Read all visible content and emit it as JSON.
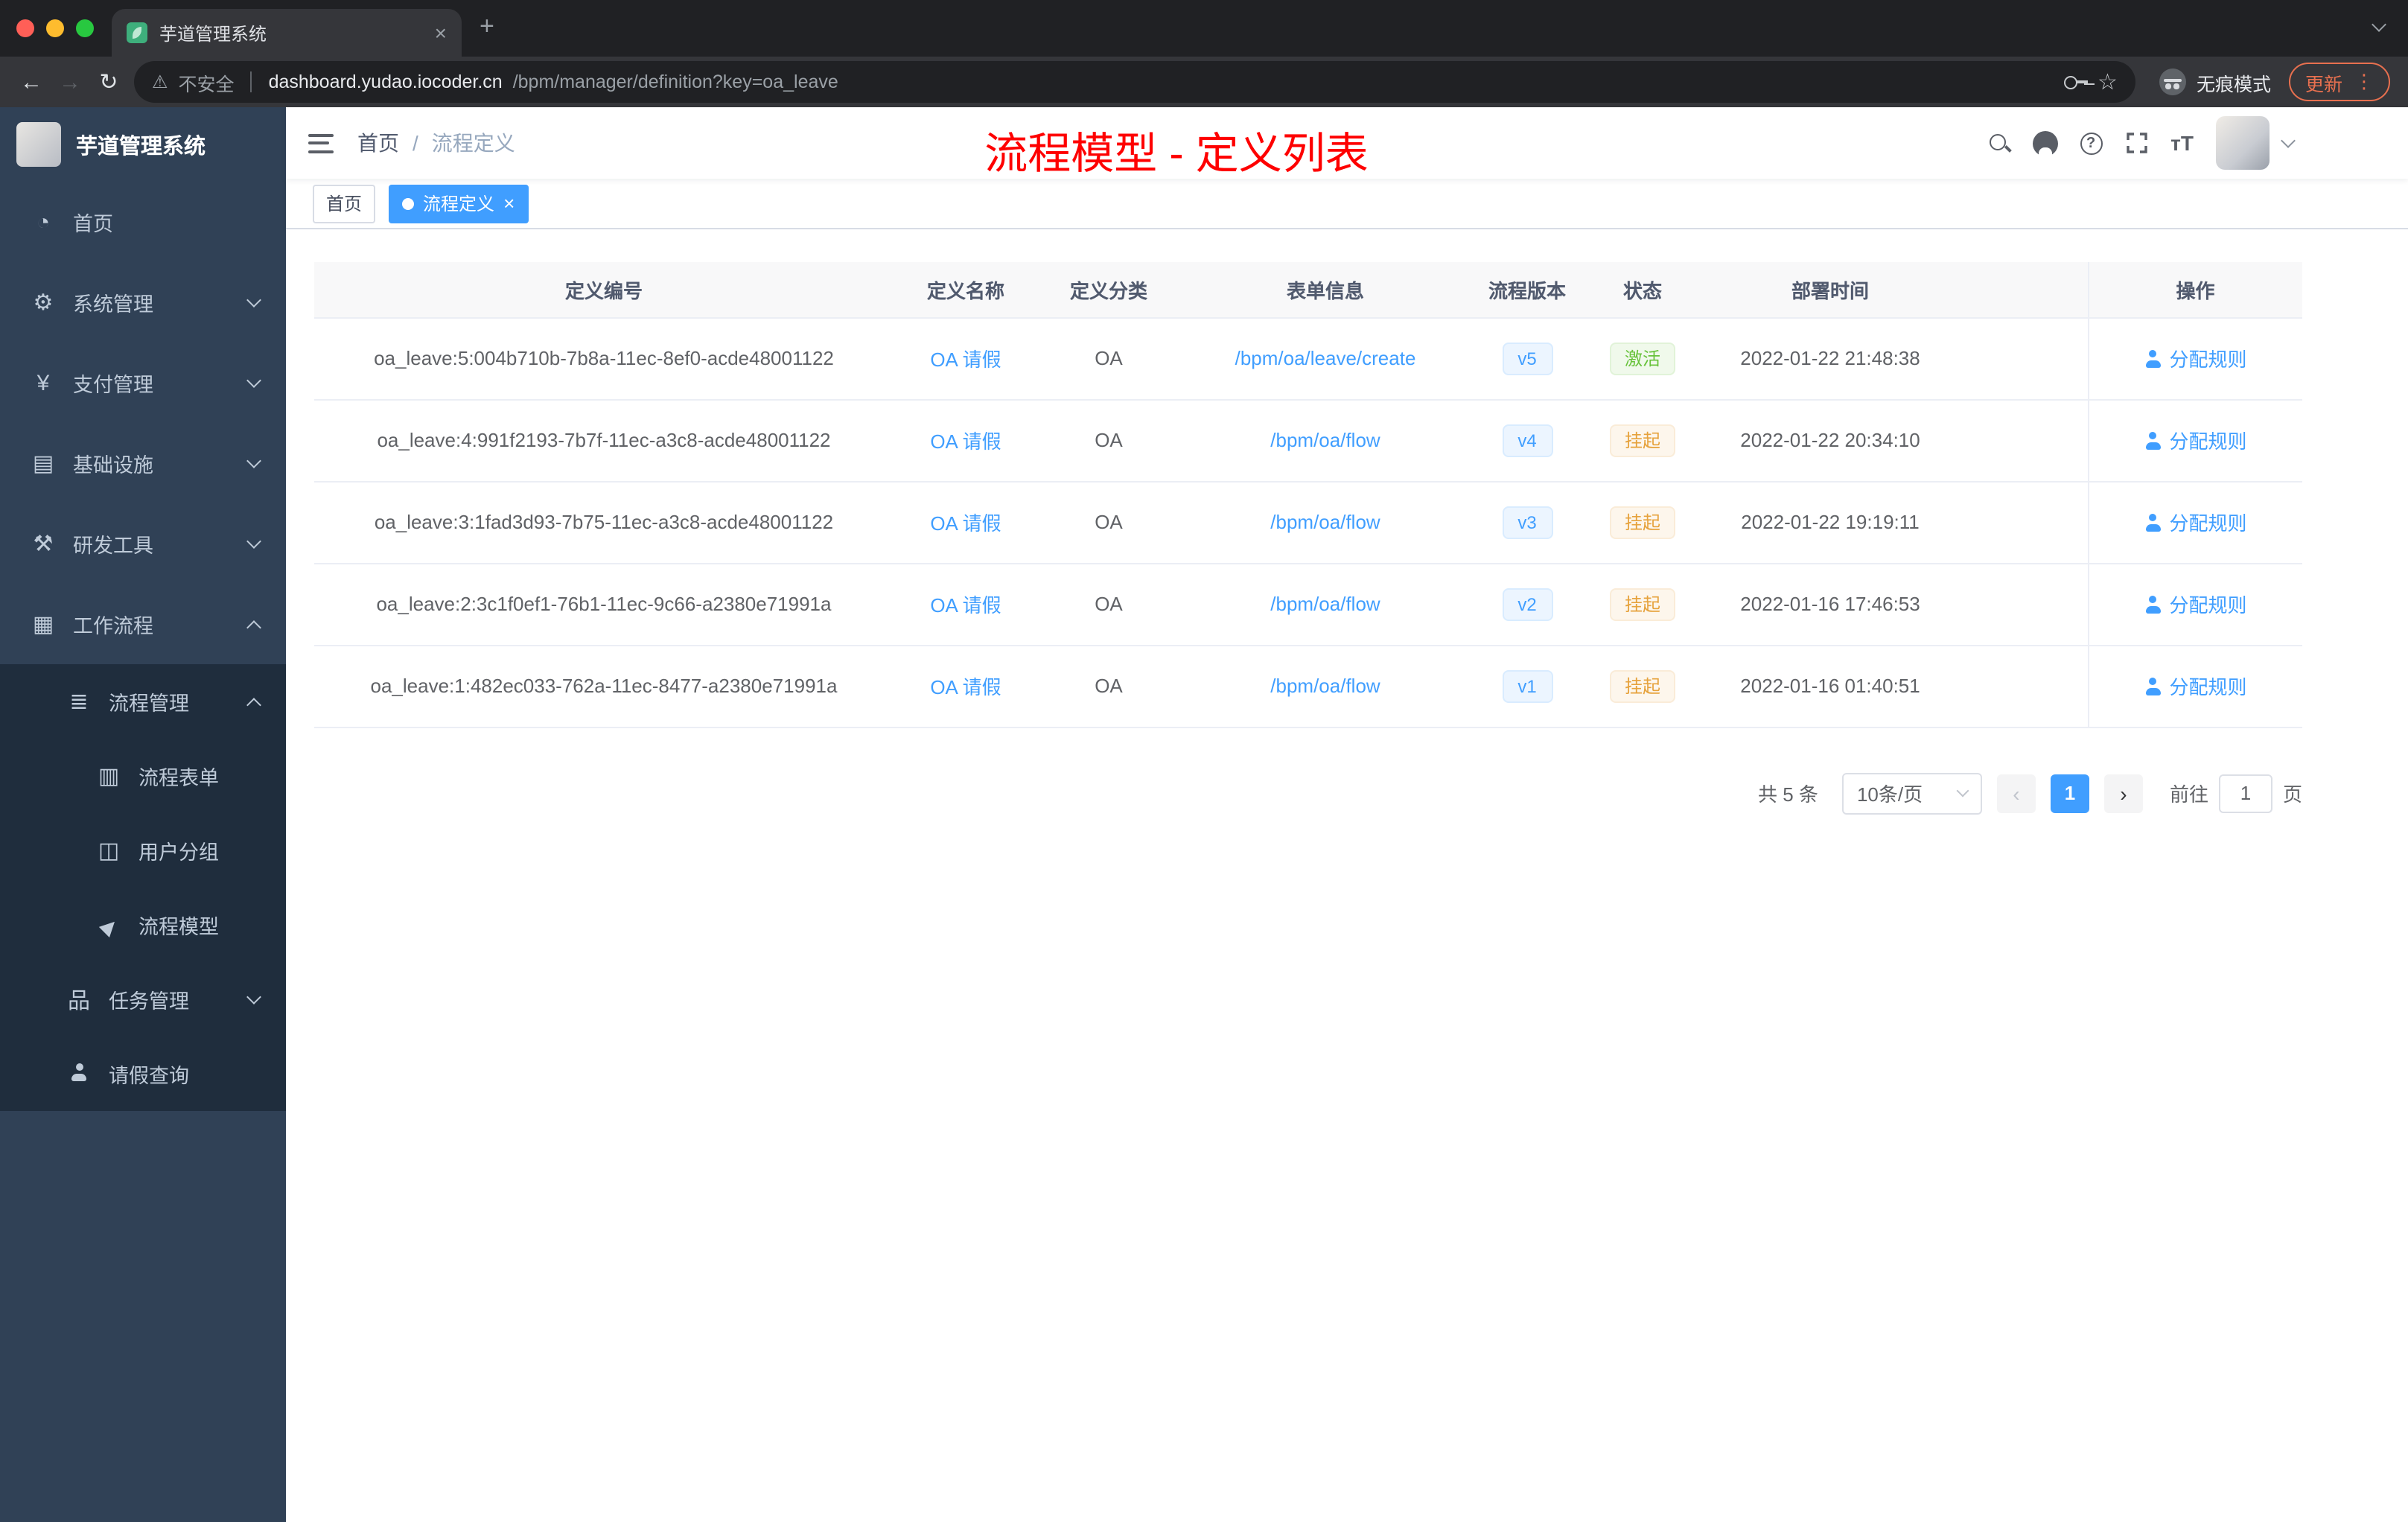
{
  "browser": {
    "tab_title": "芋道管理系统",
    "security_label": "不安全",
    "url_domain": "dashboard.yudao.iocoder.cn",
    "url_path": "/bpm/manager/definition?key=oa_leave",
    "incognito_label": "无痕模式",
    "update_label": "更新"
  },
  "icons": {
    "back": "←",
    "forward": "→",
    "reload": "↻",
    "warning": "⚠",
    "star": "☆",
    "menu_dots": "⋮",
    "new_tab": "+",
    "close": "×",
    "dashboard": "◔",
    "gear": "⚙",
    "yen": "¥",
    "infra": "▤",
    "tools": "⚒",
    "workflow": "▦",
    "list": "≣",
    "form": "▥",
    "group": "◫",
    "send": "▶",
    "tree": "品",
    "help": "?",
    "font_size": "тT",
    "prev": "‹",
    "next": "›"
  },
  "sidebar": {
    "logo_title": "芋道管理系统",
    "items": [
      {
        "label": "首页"
      },
      {
        "label": "系统管理"
      },
      {
        "label": "支付管理"
      },
      {
        "label": "基础设施"
      },
      {
        "label": "研发工具"
      },
      {
        "label": "工作流程"
      },
      {
        "label": "流程管理"
      },
      {
        "label": "流程表单"
      },
      {
        "label": "用户分组"
      },
      {
        "label": "流程模型"
      },
      {
        "label": "任务管理"
      },
      {
        "label": "请假查询"
      }
    ]
  },
  "header": {
    "breadcrumb_home": "首页",
    "breadcrumb_current": "流程定义",
    "annotation": "流程模型 - 定义列表"
  },
  "tags": {
    "home": "首页",
    "active": "流程定义"
  },
  "table": {
    "columns": [
      "定义编号",
      "定义名称",
      "定义分类",
      "表单信息",
      "流程版本",
      "状态",
      "部署时间",
      "操作"
    ],
    "rows": [
      {
        "id": "oa_leave:5:004b710b-7b8a-11ec-8ef0-acde48001122",
        "name": "OA 请假",
        "category": "OA",
        "form": "/bpm/oa/leave/create",
        "version": "v5",
        "status": "激活",
        "deployed_at": "2022-01-22 21:48:38",
        "action": "分配规则"
      },
      {
        "id": "oa_leave:4:991f2193-7b7f-11ec-a3c8-acde48001122",
        "name": "OA 请假",
        "category": "OA",
        "form": "/bpm/oa/flow",
        "version": "v4",
        "status": "挂起",
        "deployed_at": "2022-01-22 20:34:10",
        "action": "分配规则"
      },
      {
        "id": "oa_leave:3:1fad3d93-7b75-11ec-a3c8-acde48001122",
        "name": "OA 请假",
        "category": "OA",
        "form": "/bpm/oa/flow",
        "version": "v3",
        "status": "挂起",
        "deployed_at": "2022-01-22 19:19:11",
        "action": "分配规则"
      },
      {
        "id": "oa_leave:2:3c1f0ef1-76b1-11ec-9c66-a2380e71991a",
        "name": "OA 请假",
        "category": "OA",
        "form": "/bpm/oa/flow",
        "version": "v2",
        "status": "挂起",
        "deployed_at": "2022-01-16 17:46:53",
        "action": "分配规则"
      },
      {
        "id": "oa_leave:1:482ec033-762a-11ec-8477-a2380e71991a",
        "name": "OA 请假",
        "category": "OA",
        "form": "/bpm/oa/flow",
        "version": "v1",
        "status": "挂起",
        "deployed_at": "2022-01-16 01:40:51",
        "action": "分配规则"
      }
    ]
  },
  "pagination": {
    "total": "共 5 条",
    "page_size": "10条/页",
    "current_page": "1",
    "goto_label": "前往",
    "goto_value": "1",
    "goto_unit": "页"
  },
  "colors": {
    "accent": "#409eff",
    "success": "#67c23a",
    "warning": "#e6a23c",
    "sidebar_bg": "#304156",
    "submenu_bg": "#1f2d3d",
    "annotation_red": "#fe0000"
  }
}
